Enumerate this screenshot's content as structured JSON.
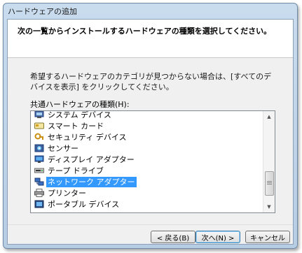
{
  "window": {
    "title": "ハードウェアの追加"
  },
  "header": {
    "text": "次の一覧からインストールするハードウェアの種類を選択してください。"
  },
  "instruction": "希望するハードウェアのカテゴリが見つからない場合は、[すべてのデバイスを表示] をクリックしてください。",
  "list": {
    "label": "共通ハードウェアの種類(H):",
    "items": [
      {
        "label": "システム デバイス",
        "icon": "system-device-icon"
      },
      {
        "label": "スマート カード",
        "icon": "smart-card-icon"
      },
      {
        "label": "セキュリティ デバイス",
        "icon": "security-device-icon"
      },
      {
        "label": "センサー",
        "icon": "sensor-icon"
      },
      {
        "label": "ディスプレイ アダプター",
        "icon": "display-adapter-icon"
      },
      {
        "label": "テープ ドライブ",
        "icon": "tape-drive-icon"
      },
      {
        "label": "ネットワーク アダプター",
        "icon": "network-adapter-icon"
      },
      {
        "label": "プリンター",
        "icon": "printer-icon"
      },
      {
        "label": "ポータブル デバイス",
        "icon": "portable-device-icon"
      }
    ],
    "selected_index": 6
  },
  "buttons": {
    "back": "< 戻る(B)",
    "next": "次へ(N) >",
    "cancel": "キャンセル"
  }
}
